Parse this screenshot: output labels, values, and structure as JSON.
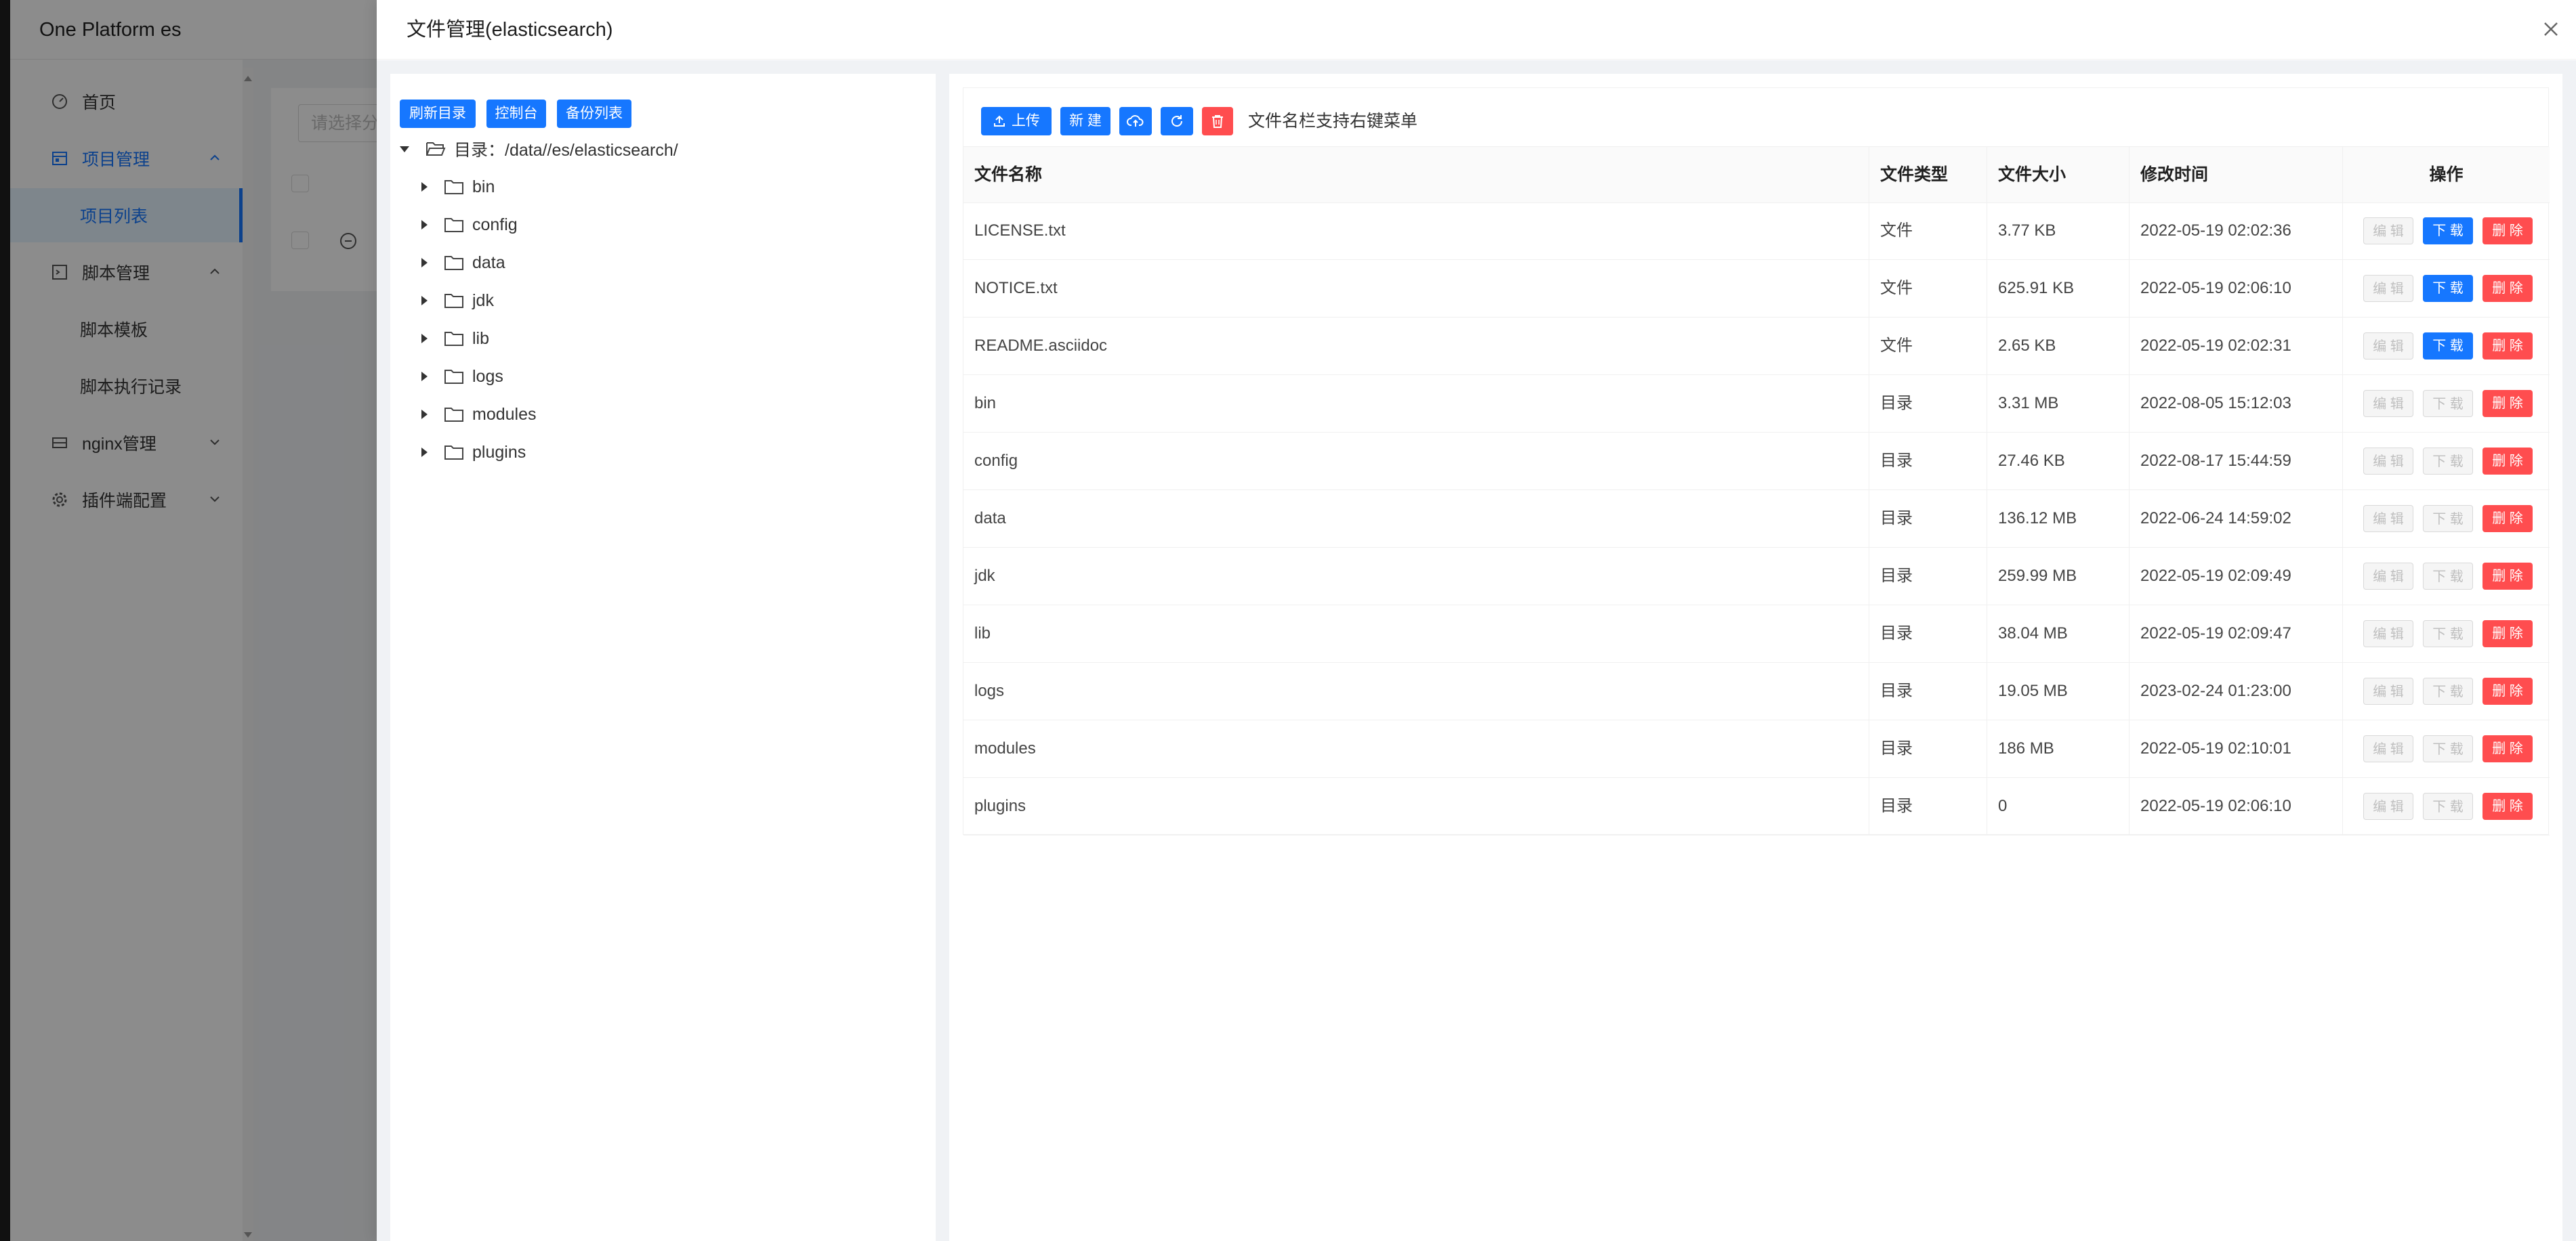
{
  "app": {
    "title": "One Platform es"
  },
  "sidebar": {
    "items": [
      {
        "label": "首页",
        "icon": "dashboard-icon"
      },
      {
        "label": "项目管理",
        "icon": "project-icon",
        "expanded": true,
        "active": true
      },
      {
        "label": "项目列表",
        "sub": true,
        "selected": true
      },
      {
        "label": "脚本管理",
        "icon": "script-icon",
        "expanded": true
      },
      {
        "label": "脚本模板",
        "sub": true
      },
      {
        "label": "脚本执行记录",
        "sub": true
      },
      {
        "label": "nginx管理",
        "icon": "nginx-icon",
        "expanded": false
      },
      {
        "label": "插件端配置",
        "icon": "gear-icon",
        "expanded": false
      }
    ]
  },
  "background": {
    "select_placeholder": "请选择分"
  },
  "drawer": {
    "title": "文件管理(elasticsearch)",
    "tree": {
      "buttons": [
        "刷新目录",
        "控制台",
        "备份列表"
      ],
      "root_label": "目录：/data//es/elasticsearch/",
      "children": [
        "bin",
        "config",
        "data",
        "jdk",
        "lib",
        "logs",
        "modules",
        "plugins"
      ]
    },
    "toolbar": {
      "upload_label": "上传",
      "new_label": "新 建",
      "hint": "文件名栏支持右键菜单"
    },
    "table": {
      "columns": [
        "文件名称",
        "文件类型",
        "文件大小",
        "修改时间",
        "操作"
      ],
      "action_labels": {
        "edit": "编 辑",
        "download": "下 载",
        "delete": "删 除"
      },
      "rows": [
        {
          "name": "LICENSE.txt",
          "type": "文件",
          "size": "3.77 KB",
          "mtime": "2022-05-19 02:02:36",
          "downloadable": true
        },
        {
          "name": "NOTICE.txt",
          "type": "文件",
          "size": "625.91 KB",
          "mtime": "2022-05-19 02:06:10",
          "downloadable": true
        },
        {
          "name": "README.asciidoc",
          "type": "文件",
          "size": "2.65 KB",
          "mtime": "2022-05-19 02:02:31",
          "downloadable": true
        },
        {
          "name": "bin",
          "type": "目录",
          "size": "3.31 MB",
          "mtime": "2022-08-05 15:12:03",
          "downloadable": false
        },
        {
          "name": "config",
          "type": "目录",
          "size": "27.46 KB",
          "mtime": "2022-08-17 15:44:59",
          "downloadable": false
        },
        {
          "name": "data",
          "type": "目录",
          "size": "136.12 MB",
          "mtime": "2022-06-24 14:59:02",
          "downloadable": false
        },
        {
          "name": "jdk",
          "type": "目录",
          "size": "259.99 MB",
          "mtime": "2022-05-19 02:09:49",
          "downloadable": false
        },
        {
          "name": "lib",
          "type": "目录",
          "size": "38.04 MB",
          "mtime": "2022-05-19 02:09:47",
          "downloadable": false
        },
        {
          "name": "logs",
          "type": "目录",
          "size": "19.05 MB",
          "mtime": "2023-02-24 01:23:00",
          "downloadable": false
        },
        {
          "name": "modules",
          "type": "目录",
          "size": "186 MB",
          "mtime": "2022-05-19 02:10:01",
          "downloadable": false
        },
        {
          "name": "plugins",
          "type": "目录",
          "size": "0",
          "mtime": "2022-05-19 02:06:10",
          "downloadable": false
        }
      ]
    }
  },
  "colors": {
    "primary": "#1677ff",
    "danger": "#ff4d4f",
    "mask": "rgba(0,0,0,0.45)"
  }
}
